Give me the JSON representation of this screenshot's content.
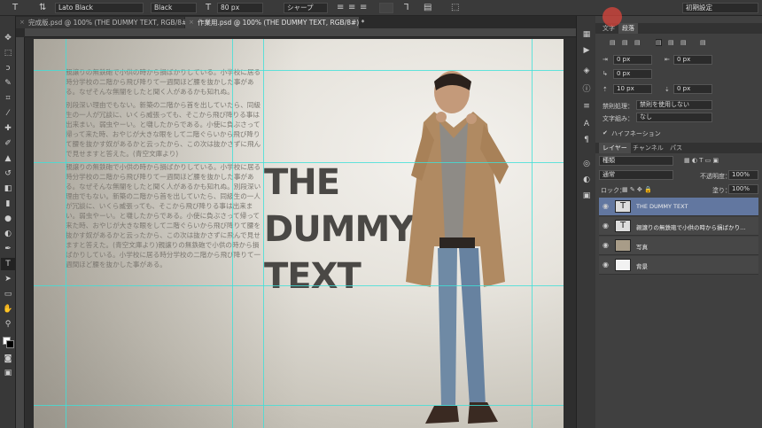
{
  "options_bar": {
    "font_family": "Lato Black",
    "font_style": "Black",
    "font_size": "80 px",
    "antialias": "シャープ",
    "workspace": "初期設定"
  },
  "tabs": [
    {
      "label": "完成版.psd @ 100% (THE DUMMY TEXT, RGB/8#) *"
    },
    {
      "label": "作業用.psd @ 100% (THE DUMMY TEXT, RGB/8#) *"
    }
  ],
  "canvas": {
    "headline": [
      "THE",
      "DUMMY",
      "TEXT"
    ],
    "body_paragraphs": [
      "親譲りの無鉄砲で小供の時から損ばかりしている。小学校に居る時分学校の二階から飛び降りて一週間ほど腰を抜かした事がある。なぜそんな無闇をしたと聞く人があるかも知れぬ。",
      "別段深い理由でもない。新築の二階から首を出していたら、同級生の一人が冗談に、いくら威張っても、そこから飛び降りる事は出来まい。弱虫やーい。と囃したからである。小使に負ぶさって帰って来た時、おやじが大きな眼をして二階ぐらいから飛び降りて腰を抜かす奴があるかと云ったから、この次は抜かさずに飛んで見せますと答えた。(青空文庫より)",
      "親譲りの無鉄砲で小供の時から損ばかりしている。小学校に居る時分学校の二階から飛び降りて一週間ほど腰を抜かした事がある。なぜそんな無闇をしたと聞く人があるかも知れぬ。別段深い理由でもない。新築の二階から首を出していたら、同級生の一人が冗談に、いくら威張っても、そこから飛び降りる事は出来まい。弱虫やーい。と囃したからである。小使に負ぶさって帰って来た時、おやじが大きな眼をして二階ぐらいから飛び降りて腰を抜かす奴があるかと云ったから、この次は抜かさずに飛んで見せますと答えた。(青空文庫より)親譲りの無鉄砲で小供の時から損ばかりしている。小学校に居る時分学校の二階から飛び降りて一週間ほど腰を抜かした事がある。"
    ]
  },
  "panel": {
    "tab_char": "文字",
    "tab_para": "段落",
    "indent_left": "0 px",
    "indent_right": "0 px",
    "indent_first": "0 px",
    "space_before": "10 px",
    "space_after": "0 px",
    "kinsoku_label": "禁則処理：",
    "kinsoku_value": "禁則を使用しない",
    "mojigumi_label": "文字組み：",
    "mojigumi_value": "なし",
    "hyphenation": "ハイフネーション"
  },
  "layers": {
    "tabs": [
      "レイヤー",
      "チャンネル",
      "パス"
    ],
    "filter": "種類",
    "blend_mode": "通常",
    "opacity_label": "不透明度：",
    "opacity_value": "100%",
    "lock_label": "ロック：",
    "fill_label": "塗り：",
    "fill_value": "100%",
    "items": [
      {
        "name": "THE DUMMY TEXT",
        "thumb": "T"
      },
      {
        "name": "親譲りの無鉄砲で小供の時から損ばかり…",
        "thumb": "T"
      },
      {
        "name": "写真",
        "thumb": ""
      },
      {
        "name": "背景",
        "thumb": ""
      }
    ]
  }
}
